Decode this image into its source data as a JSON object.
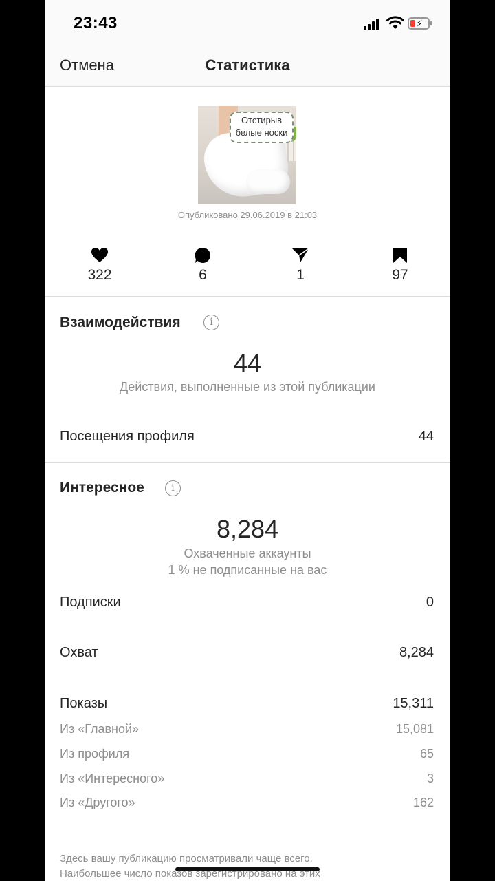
{
  "status": {
    "time": "23:43"
  },
  "nav": {
    "cancel": "Отмена",
    "title": "Статистика"
  },
  "post": {
    "thumb_text_line1": "Отстирыв",
    "thumb_text_line2": "белые носки",
    "published": "Опубликовано 29.06.2019 в 21:03"
  },
  "metrics": [
    {
      "icon": "heart-icon",
      "value": "322"
    },
    {
      "icon": "comment-icon",
      "value": "6"
    },
    {
      "icon": "send-icon",
      "value": "1"
    },
    {
      "icon": "bookmark-icon",
      "value": "97"
    }
  ],
  "interactions": {
    "title": "Взаимодействия",
    "total": "44",
    "caption": "Действия, выполненные из этой публикации",
    "rows": [
      {
        "label": "Посещения профиля",
        "value": "44"
      }
    ]
  },
  "discovery": {
    "title": "Интересное",
    "total": "8,284",
    "caption1": "Охваченные аккаунты",
    "caption2": "1 % не подписанные на вас",
    "rows": [
      {
        "label": "Подписки",
        "value": "0"
      },
      {
        "label": "Охват",
        "value": "8,284"
      },
      {
        "label": "Показы",
        "value": "15,311"
      }
    ],
    "impressions": [
      {
        "label": "Из «Главной»",
        "value": "15,081"
      },
      {
        "label": "Из профиля",
        "value": "65"
      },
      {
        "label": "Из «Интересного»",
        "value": "3"
      },
      {
        "label": "Из «Другого»",
        "value": "162"
      }
    ]
  },
  "footer": {
    "line1": "Здесь вашу публикацию просматривали чаще всего.",
    "line2": "Наибольшее число показов зарегистрировано на этих"
  },
  "colors": {
    "text": "#262626",
    "secondary": "#8e8e8e",
    "divider": "#dbdbdb",
    "battery_low": "#ff3b30"
  }
}
